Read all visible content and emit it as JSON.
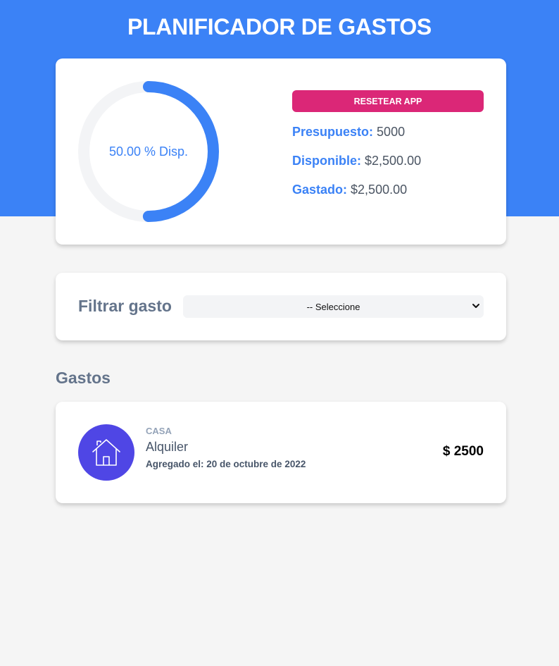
{
  "header": {
    "title": "PLANIFICADOR DE GASTOS",
    "background_color": "#3b82f6"
  },
  "budget": {
    "progress_label": "50.00 % Disp.",
    "progress_fraction_spent": 0.5,
    "reset_label": "RESETEAR APP",
    "reset_color": "#db2777",
    "presupuesto_label": "Presupuesto:",
    "presupuesto_value": "5000",
    "disponible_label": "Disponible:",
    "disponible_value": "$2,500.00",
    "gastado_label": "Gastado:",
    "gastado_value": "$2,500.00"
  },
  "filter": {
    "label": "Filtrar gasto",
    "selected_option": "-- Seleccione"
  },
  "expenses": {
    "section_title": "Gastos",
    "items": [
      {
        "icon": "house-icon",
        "icon_color": "#4f46e5",
        "category": "CASA",
        "name": "Alquiler",
        "date_label": "Agregado el:",
        "date_value": "20 de octubre de 2022",
        "amount": "$ 2500"
      }
    ]
  }
}
